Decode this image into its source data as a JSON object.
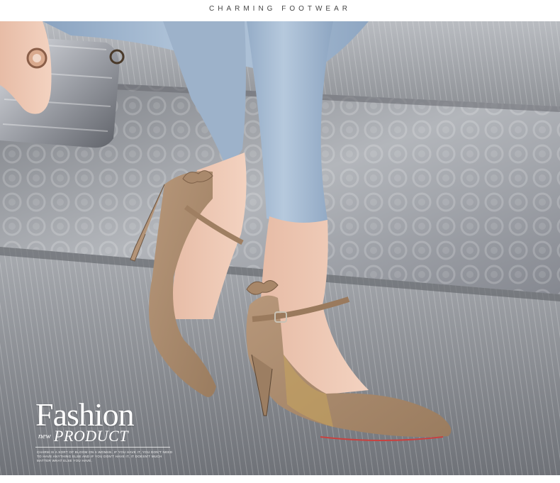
{
  "header": {
    "title": "CHARMING FOOTWEAR"
  },
  "photo": {
    "subject": "shoe-photo",
    "colors": {
      "shoe": "#a98a6c",
      "denim": "#9fb6cf",
      "metal_floor": "#9a9ca1",
      "skin": "#efc9b6"
    }
  },
  "caption": {
    "title": "Fashion",
    "new": "new",
    "product": "PRODUCT",
    "body_lines": [
      "CHARM IS A SORT OF BLOOM ON A WOMAN. IF YOU HAVE IT, YOU DON'T NEED",
      "TO HAVE ANYTHING ELSE AND IF YOU DON'T HAVE IT, IT DOESN'T MUCH",
      "MATTER WHAT ELSE YOU HAVE."
    ]
  }
}
